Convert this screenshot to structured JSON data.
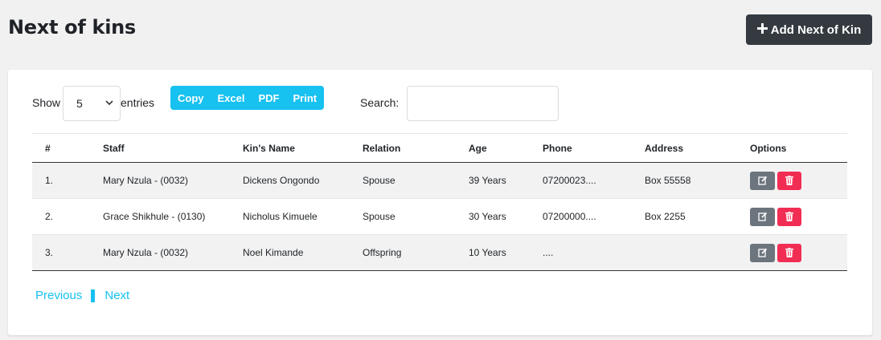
{
  "page": {
    "title": "Next of kins",
    "add_button_label": "Add Next of Kin",
    "add_icon": "plus-icon"
  },
  "controls": {
    "show_label": "Show",
    "entries_value": "5",
    "entries_label": "entries",
    "export_buttons": [
      "Copy",
      "Excel",
      "PDF",
      "Print"
    ],
    "search_label": "Search:",
    "search_value": ""
  },
  "table": {
    "headers": [
      "#",
      "Staff",
      "Kin's Name",
      "Relation",
      "Age",
      "Phone",
      "Address",
      "Options"
    ],
    "rows": [
      [
        "1.",
        "Mary Nzula - (0032)",
        "Dickens Ongondo",
        "Spouse",
        "39 Years",
        "07200023....",
        "Box 55558"
      ],
      [
        "2.",
        "Grace Shikhule - (0130)",
        "Nicholus Kimuele",
        "Spouse",
        "30 Years",
        "07200000....",
        "Box 2255"
      ],
      [
        "3.",
        "Mary Nzula - (0032)",
        "Noel Kimande",
        "Offspring",
        "10 Years",
        "....",
        ""
      ]
    ],
    "row_actions": {
      "edit_icon": "edit-icon",
      "delete_icon": "trash-icon"
    }
  },
  "pagination": {
    "previous": "Previous",
    "next": "Next"
  },
  "colors": {
    "accent": "#17c1f0",
    "dark_button": "#343a40",
    "edit_button": "#6c757d",
    "delete_button": "#f22d54"
  }
}
